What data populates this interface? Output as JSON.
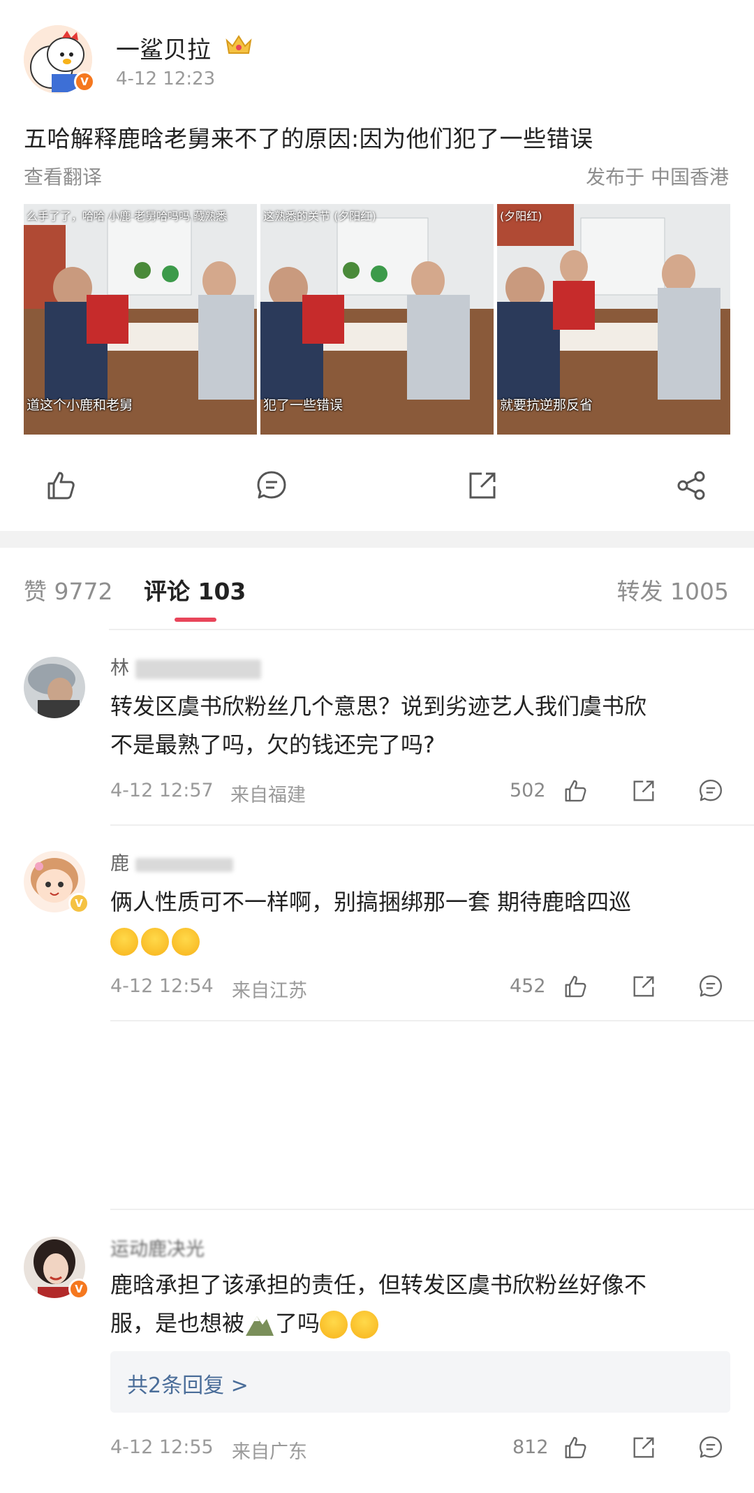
{
  "post": {
    "author": "一鲨贝拉",
    "time": "4-12 12:23",
    "text": "五哈解释鹿晗老舅来不了的原因:因为他们犯了一些错误",
    "translate": "查看翻译",
    "location": "发布于 中国香港",
    "images": [
      {
        "top_caption": "么手了了，哈哈    小鹿 老舅哈吗吗    藏熟悉",
        "bottom_caption": "道这个小鹿和老舅"
      },
      {
        "top_caption": "这熟悉的关节            (夕阳红)",
        "bottom_caption": "犯了一些错误"
      },
      {
        "top_caption": "(夕阳红)",
        "bottom_caption": "就要抗逆那反省"
      }
    ]
  },
  "tabs": {
    "likes": "赞 9772",
    "comments": "评论 103",
    "reposts": "转发 1005"
  },
  "comments": [
    {
      "name": "林",
      "text_line1": "转发区虞书欣粉丝几个意思？说到劣迹艺人我们虞书欣",
      "text_line2": "不是最熟了吗，欠的钱还完了吗?",
      "time": "4-12 12:57",
      "from": "来自福建",
      "likes": "502"
    },
    {
      "name": "鹿",
      "text_line1": "俩人性质可不一样啊，别搞捆绑那一套  期待鹿晗四巡",
      "time": "4-12 12:54",
      "from": "来自江苏",
      "likes": "452"
    },
    {
      "name": "运动鹿决光",
      "text_line1": "鹿晗承担了该承担的责任，但转发区虞书欣粉丝好像不",
      "text_line2": "服，是也想被",
      "text_tail": "了吗",
      "replies": "共2条回复 >",
      "time": "4-12 12:55",
      "from": "来自广东",
      "likes": "812"
    }
  ],
  "colors": {
    "accent": "#e8455a",
    "link": "#4a6d99",
    "vip_orange": "#f5781f"
  }
}
